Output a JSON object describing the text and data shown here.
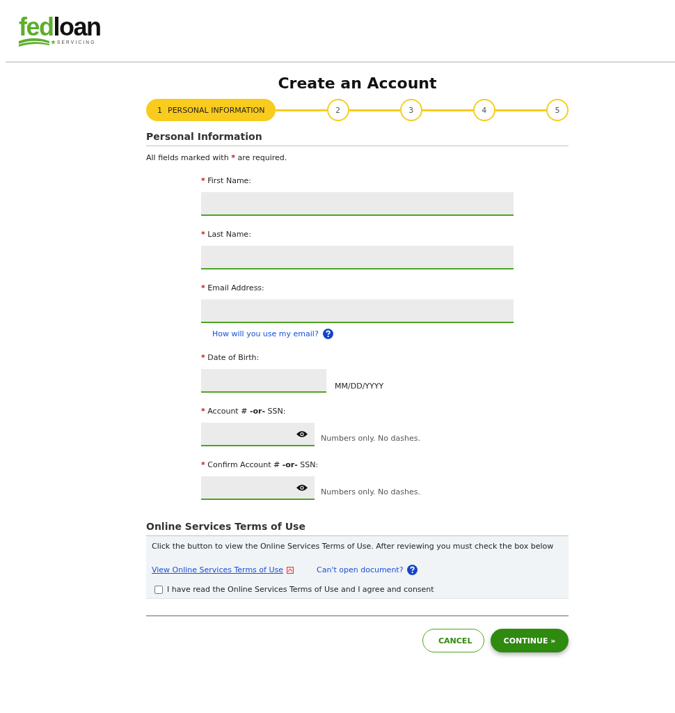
{
  "logo": {
    "part1": "fed",
    "part2": "loan",
    "tagline": "SERVICING"
  },
  "title": "Create an Account",
  "steps": [
    {
      "number": "1",
      "label": "PERSONAL INFORMATION",
      "selected": true
    },
    {
      "number": "2",
      "selected": false
    },
    {
      "number": "3",
      "selected": false
    },
    {
      "number": "4",
      "selected": false
    },
    {
      "number": "5",
      "selected": false
    }
  ],
  "section_title": "Personal Information",
  "intro": {
    "before": "All fields marked with",
    "mark": "*",
    "after": "are required."
  },
  "fields": [
    {
      "kind": "text",
      "mark": "*",
      "label": "First Name:"
    },
    {
      "kind": "text",
      "mark": "*",
      "label": "Last Name:"
    },
    {
      "kind": "text",
      "mark": "*",
      "label": "Email Address:",
      "help": "How will you use my email?"
    },
    {
      "kind": "date",
      "mark": "*",
      "label": "Date of Birth:",
      "hint": "MM/DD/YYYY"
    },
    {
      "kind": "secret",
      "mark": "*",
      "label": "Account # **-or-** SSN:",
      "hint": "Numbers only. No dashes."
    },
    {
      "kind": "secret",
      "mark": "*",
      "label": "Confirm Account # **-or-** SSN:",
      "hint": "Numbers only. No dashes."
    }
  ],
  "terms": {
    "title": "Online Services Terms of Use",
    "text": "Click the button to view the Online Services Terms of Use. After reviewing you must check the box below",
    "view_link": "View Online Services Terms of Use",
    "help_link": "Can't open document?",
    "consent": "I have read the Online Services Terms of Use and I agree and consent",
    "checked": false
  },
  "buttons": {
    "cancel": "CANCEL",
    "continue": "CONTINUE »"
  }
}
